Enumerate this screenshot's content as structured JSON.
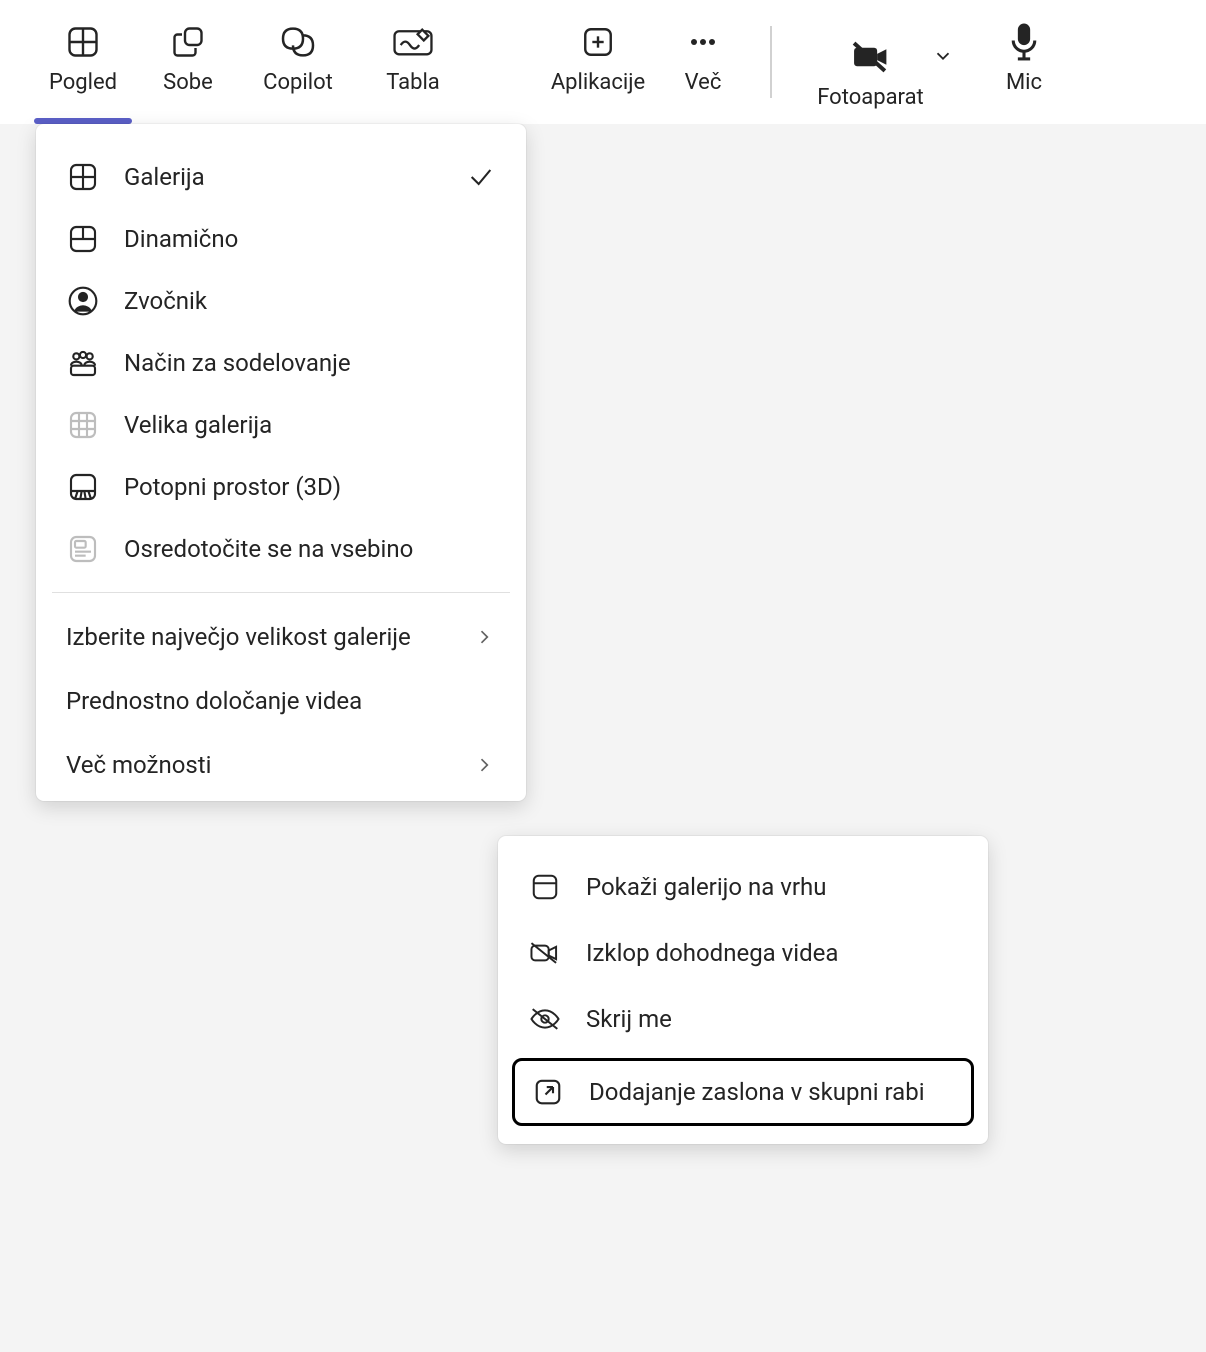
{
  "toolbar": {
    "items": [
      {
        "label": "Pogled"
      },
      {
        "label": "Sobe"
      },
      {
        "label": "Copilot"
      },
      {
        "label": "Tabla"
      },
      {
        "label": "Aplikacije"
      },
      {
        "label": "Več"
      },
      {
        "label": "Fotoaparat"
      },
      {
        "label": "Mic"
      }
    ]
  },
  "view_menu": {
    "items": [
      {
        "label": "Galerija",
        "checked": true
      },
      {
        "label": "Dinamično"
      },
      {
        "label": "Zvočnik"
      },
      {
        "label": "Način za sodelovanje"
      },
      {
        "label": "Velika galerija"
      },
      {
        "label": "Potopni prostor (3D)"
      },
      {
        "label": "Osredotočite se na vsebino"
      }
    ],
    "sections": [
      {
        "label": "Izberite največjo velikost galerije",
        "chevron": true
      },
      {
        "label": "Prednostno določanje videa"
      },
      {
        "label": "Več možnosti",
        "chevron": true
      }
    ]
  },
  "more_menu": {
    "items": [
      {
        "label": "Pokaži galerijo na vrhu"
      },
      {
        "label": "Izklop dohodnega videa"
      },
      {
        "label": "Skrij me"
      },
      {
        "label": "Dodajanje zaslona v skupni rabi"
      }
    ]
  }
}
